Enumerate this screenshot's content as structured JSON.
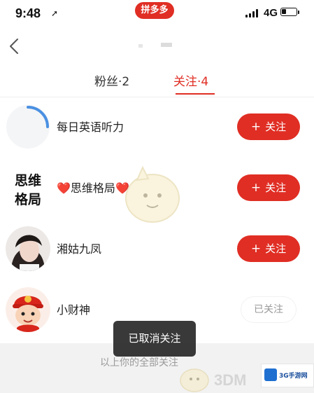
{
  "status_bar": {
    "time": "9:48",
    "location_arrow": "➚",
    "network": "4G",
    "app_badge": "拼多多"
  },
  "nav": {
    "title": "..."
  },
  "tabs": {
    "fans_label": "粉丝·2",
    "following_label": "关注·4",
    "active": "关注"
  },
  "rows": [
    {
      "name": "每日英语听力",
      "button": "关注",
      "followed": false,
      "avatar": "loading-spinner"
    },
    {
      "name_prefix": "❤️",
      "name": "思维格局",
      "name_suffix": "❤️",
      "button": "关注",
      "followed": false,
      "avatar": "calligraphy-logo",
      "avatar_text": [
        "思维",
        "格局"
      ]
    },
    {
      "name": "湘姑九凤",
      "button": "关注",
      "followed": false,
      "avatar": "portrait-photo"
    },
    {
      "name": "小财神",
      "button": "已关注",
      "followed": true,
      "avatar": "cartoon-character"
    }
  ],
  "toast": "已取消关注",
  "footer_text": "以上你的全部关注",
  "watermark": {
    "text": "3DM",
    "logo_text": "3G手游网"
  },
  "colors": {
    "accent": "#e02e24",
    "tab_active": "#e02e24",
    "footer_bg": "#f2f2f2",
    "toast_bg": "#1e1e1e"
  }
}
